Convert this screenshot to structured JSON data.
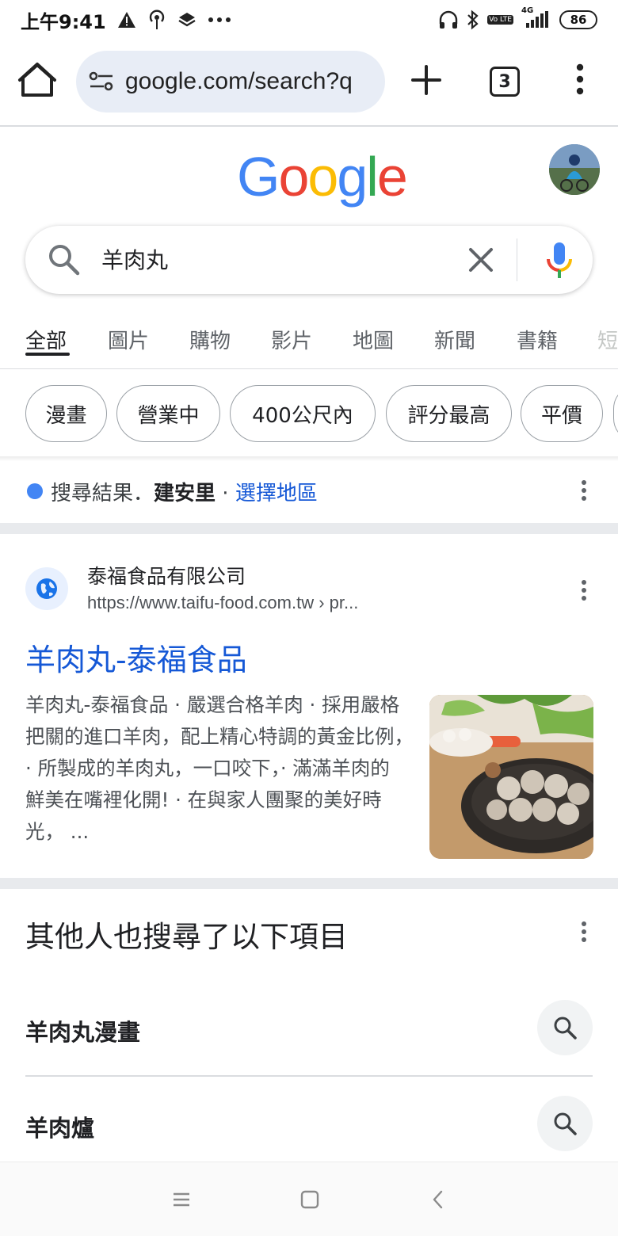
{
  "status_bar": {
    "time": "上午9:41",
    "battery": "86",
    "network": "4G",
    "lte_label": "Vo LTE"
  },
  "browser": {
    "url": "google.com/search?q",
    "tab_count": "3"
  },
  "search": {
    "query": "羊肉丸",
    "logo_letters": [
      "G",
      "o",
      "o",
      "g",
      "l",
      "e"
    ],
    "logo_colors": [
      "#4285F4",
      "#EA4335",
      "#FBBC05",
      "#4285F4",
      "#34A853",
      "#EA4335"
    ]
  },
  "tabs": [
    "全部",
    "圖片",
    "購物",
    "影片",
    "地圖",
    "新聞",
    "書籍",
    "短"
  ],
  "chips": [
    "漫畫",
    "營業中",
    "400公尺內",
    "評分最高",
    "平價"
  ],
  "location": {
    "prefix": "搜尋結果．",
    "place": "建安里",
    "separator": " · ",
    "link": "選擇地區"
  },
  "result": {
    "site_name": "泰福食品有限公司",
    "url": "https://www.taifu-food.com.tw › pr...",
    "title": "羊肉丸-泰福食品",
    "snippet": "羊肉丸-泰福食品 · 嚴選合格羊肉 · 採用嚴格把關的進口羊肉，配上精心特調的黃金比例，· 所製成的羊肉丸，一口咬下，· 滿滿羊肉的鮮美在嘴裡化開! · 在與家人團聚的美好時光， ..."
  },
  "people_also_search": {
    "title": "其他人也搜尋了以下項目",
    "items": [
      "羊肉丸漫畫",
      "羊肉爐"
    ]
  },
  "colors": {
    "link_blue": "#1558d6",
    "accent_blue": "#4285f4",
    "url_bar_bg": "#e8edf6"
  }
}
